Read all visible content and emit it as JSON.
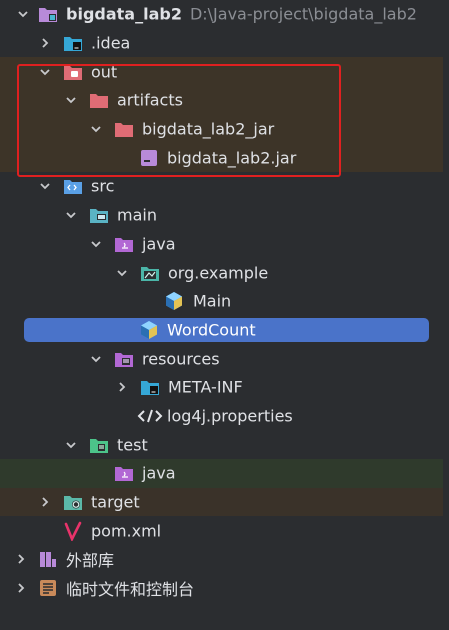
{
  "project": {
    "name": "bigdata_lab2",
    "path": "D:\\Java-project\\bigdata_lab2"
  },
  "tree": {
    "idea": ".idea",
    "out": "out",
    "artifacts": "artifacts",
    "artifact_dir": "bigdata_lab2_jar",
    "jar_file": "bigdata_lab2.jar",
    "src": "src",
    "main": "main",
    "main_java": "java",
    "package": "org.example",
    "class_main": "Main",
    "class_wordcount": "WordCount",
    "resources": "resources",
    "meta_inf": "META-INF",
    "log4j": "log4j.properties",
    "test": "test",
    "test_java": "java",
    "target": "target",
    "pom": "pom.xml",
    "external_libs": "外部库",
    "scratches": "临时文件和控制台"
  },
  "colors": {
    "selected": "#4a73c9",
    "highlight_box": "#e02020",
    "excluded_folder": "#e06c75",
    "source_folder": "#5aa0e6",
    "test_folder": "#4cc38a"
  }
}
